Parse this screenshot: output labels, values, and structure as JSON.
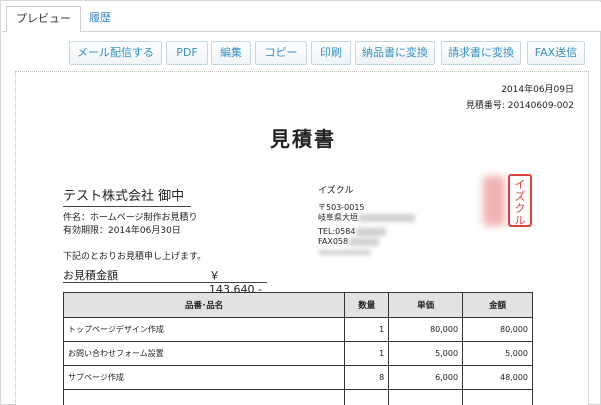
{
  "tabs": [
    {
      "label": "プレビュー",
      "active": true
    },
    {
      "label": "履歴",
      "active": false
    }
  ],
  "toolbar": {
    "email": "メール配信する",
    "pdf": "PDF",
    "edit": "編集",
    "copy": "コピー",
    "print": "印刷",
    "to_delivery": "納品書に変換",
    "to_invoice": "請求書に変換",
    "fax": "FAX送信"
  },
  "document": {
    "date": "2014年06月09日",
    "estimate_number": "見積番号: 20140609-002",
    "title": "見積書",
    "client": "テスト株式会社 御中",
    "subject": "件名：ホームページ制作お見積り",
    "validity": "有効期限：2014年06月30日",
    "intro": "下記のとおりお見積申し上げます。",
    "total_label": "お見積金額",
    "total_value": "￥ 143,640 -",
    "company": {
      "name": "イズクル",
      "postal": "〒503-0015",
      "address": "岐阜県大垣",
      "tel": "TEL:0584",
      "fax": "FAX058"
    },
    "seal_text": "イズクル",
    "table": {
      "headers": [
        "品番･品名",
        "数量",
        "単価",
        "金額"
      ],
      "rows": [
        {
          "name": "トップページデザイン作成",
          "qty": "1",
          "price": "80,000",
          "amount": "80,000"
        },
        {
          "name": "お問い合わせフォーム設置",
          "qty": "1",
          "price": "5,000",
          "amount": "5,000"
        },
        {
          "name": "サブページ作成",
          "qty": "8",
          "price": "6,000",
          "amount": "48,000"
        },
        {
          "name": "",
          "qty": "",
          "price": "",
          "amount": ""
        }
      ]
    }
  },
  "colors": {
    "link": "#3a87c8",
    "button_text": "#3591c3",
    "seal": "#e04040",
    "header_bg": "#e2e2e2"
  }
}
